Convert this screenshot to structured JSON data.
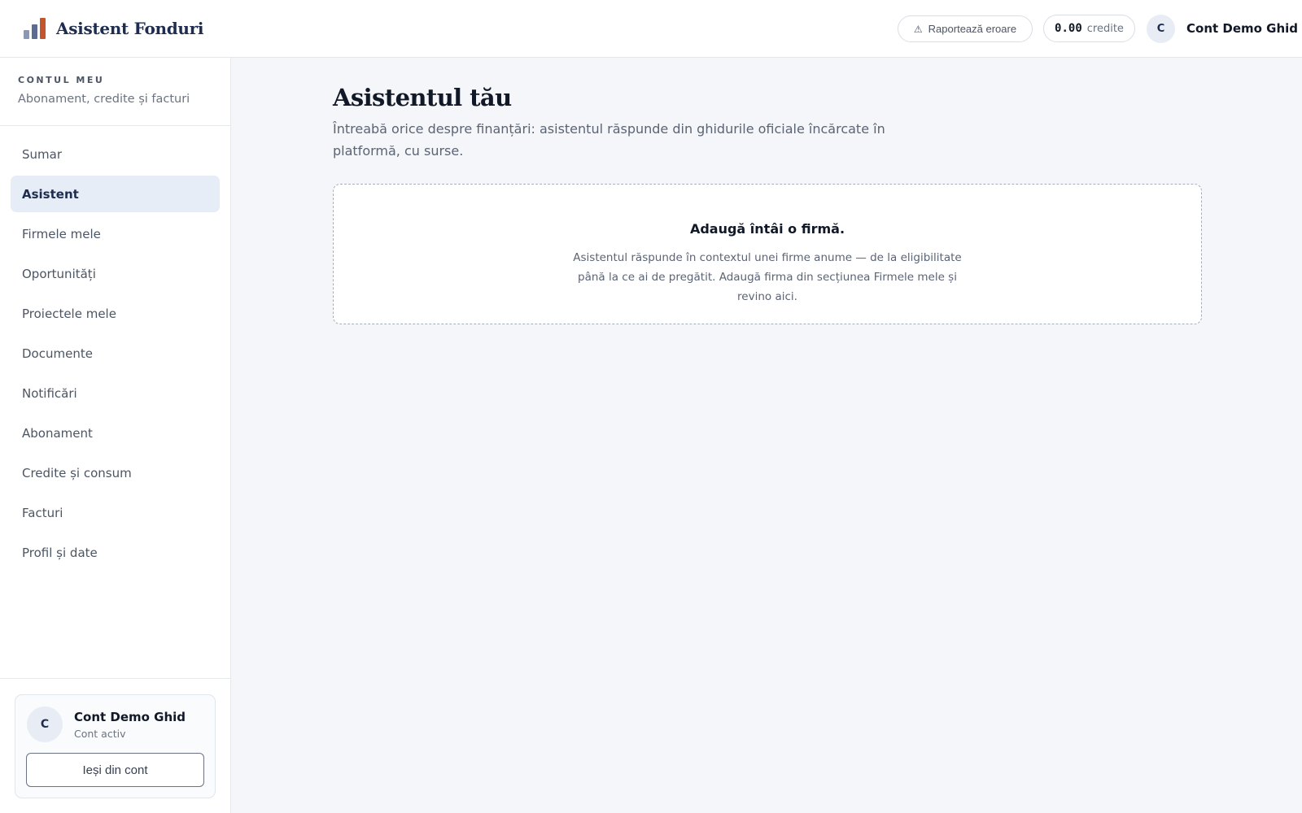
{
  "header": {
    "brand": "Asistent Fonduri",
    "report_label": "Raportează eroare",
    "report_icon": "⚠",
    "credits_amount": "0.00",
    "credits_unit": "credite",
    "avatar_initial": "C",
    "user_name": "Cont Demo Ghid"
  },
  "sidebar": {
    "eyebrow": "CONTUL MEU",
    "subtitle": "Abonament, credite și facturi",
    "items": [
      {
        "label": "Sumar"
      },
      {
        "label": "Asistent"
      },
      {
        "label": "Firmele mele"
      },
      {
        "label": "Oportunități"
      },
      {
        "label": "Proiectele mele"
      },
      {
        "label": "Documente"
      },
      {
        "label": "Notificări"
      },
      {
        "label": "Abonament"
      },
      {
        "label": "Credite și consum"
      },
      {
        "label": "Facturi"
      },
      {
        "label": "Profil și date"
      }
    ],
    "active_item": "Asistent",
    "account": {
      "initial": "C",
      "name": "Cont Demo Ghid",
      "status": "Cont activ",
      "logout_label": "Ieși din cont"
    }
  },
  "main": {
    "title": "Asistentul tău",
    "description": "Întreabă orice despre finanțări: asistentul răspunde din ghidurile oficiale încărcate în platformă, cu surse.",
    "empty_state": {
      "title": "Adaugă întâi o firmă.",
      "text": "Asistentul răspunde în contextul unei firme anume — de la eligibilitate până la ce ai de pregătit. Adaugă firma din secțiunea Firmele mele și revino aici."
    }
  },
  "colors": {
    "brand_navy": "#1e2c4f",
    "accent_orange": "#c2552c",
    "active_bg": "#e7edf7",
    "page_bg": "#f5f6fa"
  },
  "icons": {
    "logo": "bar-chart-icon",
    "report": "warning-icon"
  }
}
